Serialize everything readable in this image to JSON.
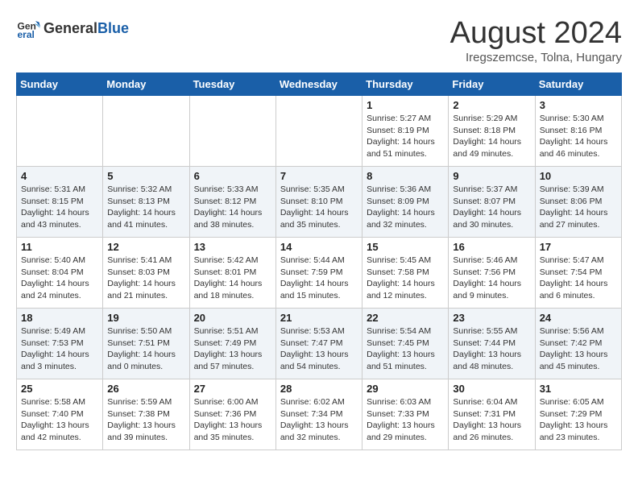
{
  "header": {
    "logo_general": "General",
    "logo_blue": "Blue",
    "title": "August 2024",
    "location": "Iregszemcse, Tolna, Hungary"
  },
  "weekdays": [
    "Sunday",
    "Monday",
    "Tuesday",
    "Wednesday",
    "Thursday",
    "Friday",
    "Saturday"
  ],
  "weeks": [
    [
      {
        "day": "",
        "info": ""
      },
      {
        "day": "",
        "info": ""
      },
      {
        "day": "",
        "info": ""
      },
      {
        "day": "",
        "info": ""
      },
      {
        "day": "1",
        "info": "Sunrise: 5:27 AM\nSunset: 8:19 PM\nDaylight: 14 hours\nand 51 minutes."
      },
      {
        "day": "2",
        "info": "Sunrise: 5:29 AM\nSunset: 8:18 PM\nDaylight: 14 hours\nand 49 minutes."
      },
      {
        "day": "3",
        "info": "Sunrise: 5:30 AM\nSunset: 8:16 PM\nDaylight: 14 hours\nand 46 minutes."
      }
    ],
    [
      {
        "day": "4",
        "info": "Sunrise: 5:31 AM\nSunset: 8:15 PM\nDaylight: 14 hours\nand 43 minutes."
      },
      {
        "day": "5",
        "info": "Sunrise: 5:32 AM\nSunset: 8:13 PM\nDaylight: 14 hours\nand 41 minutes."
      },
      {
        "day": "6",
        "info": "Sunrise: 5:33 AM\nSunset: 8:12 PM\nDaylight: 14 hours\nand 38 minutes."
      },
      {
        "day": "7",
        "info": "Sunrise: 5:35 AM\nSunset: 8:10 PM\nDaylight: 14 hours\nand 35 minutes."
      },
      {
        "day": "8",
        "info": "Sunrise: 5:36 AM\nSunset: 8:09 PM\nDaylight: 14 hours\nand 32 minutes."
      },
      {
        "day": "9",
        "info": "Sunrise: 5:37 AM\nSunset: 8:07 PM\nDaylight: 14 hours\nand 30 minutes."
      },
      {
        "day": "10",
        "info": "Sunrise: 5:39 AM\nSunset: 8:06 PM\nDaylight: 14 hours\nand 27 minutes."
      }
    ],
    [
      {
        "day": "11",
        "info": "Sunrise: 5:40 AM\nSunset: 8:04 PM\nDaylight: 14 hours\nand 24 minutes."
      },
      {
        "day": "12",
        "info": "Sunrise: 5:41 AM\nSunset: 8:03 PM\nDaylight: 14 hours\nand 21 minutes."
      },
      {
        "day": "13",
        "info": "Sunrise: 5:42 AM\nSunset: 8:01 PM\nDaylight: 14 hours\nand 18 minutes."
      },
      {
        "day": "14",
        "info": "Sunrise: 5:44 AM\nSunset: 7:59 PM\nDaylight: 14 hours\nand 15 minutes."
      },
      {
        "day": "15",
        "info": "Sunrise: 5:45 AM\nSunset: 7:58 PM\nDaylight: 14 hours\nand 12 minutes."
      },
      {
        "day": "16",
        "info": "Sunrise: 5:46 AM\nSunset: 7:56 PM\nDaylight: 14 hours\nand 9 minutes."
      },
      {
        "day": "17",
        "info": "Sunrise: 5:47 AM\nSunset: 7:54 PM\nDaylight: 14 hours\nand 6 minutes."
      }
    ],
    [
      {
        "day": "18",
        "info": "Sunrise: 5:49 AM\nSunset: 7:53 PM\nDaylight: 14 hours\nand 3 minutes."
      },
      {
        "day": "19",
        "info": "Sunrise: 5:50 AM\nSunset: 7:51 PM\nDaylight: 14 hours\nand 0 minutes."
      },
      {
        "day": "20",
        "info": "Sunrise: 5:51 AM\nSunset: 7:49 PM\nDaylight: 13 hours\nand 57 minutes."
      },
      {
        "day": "21",
        "info": "Sunrise: 5:53 AM\nSunset: 7:47 PM\nDaylight: 13 hours\nand 54 minutes."
      },
      {
        "day": "22",
        "info": "Sunrise: 5:54 AM\nSunset: 7:45 PM\nDaylight: 13 hours\nand 51 minutes."
      },
      {
        "day": "23",
        "info": "Sunrise: 5:55 AM\nSunset: 7:44 PM\nDaylight: 13 hours\nand 48 minutes."
      },
      {
        "day": "24",
        "info": "Sunrise: 5:56 AM\nSunset: 7:42 PM\nDaylight: 13 hours\nand 45 minutes."
      }
    ],
    [
      {
        "day": "25",
        "info": "Sunrise: 5:58 AM\nSunset: 7:40 PM\nDaylight: 13 hours\nand 42 minutes."
      },
      {
        "day": "26",
        "info": "Sunrise: 5:59 AM\nSunset: 7:38 PM\nDaylight: 13 hours\nand 39 minutes."
      },
      {
        "day": "27",
        "info": "Sunrise: 6:00 AM\nSunset: 7:36 PM\nDaylight: 13 hours\nand 35 minutes."
      },
      {
        "day": "28",
        "info": "Sunrise: 6:02 AM\nSunset: 7:34 PM\nDaylight: 13 hours\nand 32 minutes."
      },
      {
        "day": "29",
        "info": "Sunrise: 6:03 AM\nSunset: 7:33 PM\nDaylight: 13 hours\nand 29 minutes."
      },
      {
        "day": "30",
        "info": "Sunrise: 6:04 AM\nSunset: 7:31 PM\nDaylight: 13 hours\nand 26 minutes."
      },
      {
        "day": "31",
        "info": "Sunrise: 6:05 AM\nSunset: 7:29 PM\nDaylight: 13 hours\nand 23 minutes."
      }
    ]
  ]
}
